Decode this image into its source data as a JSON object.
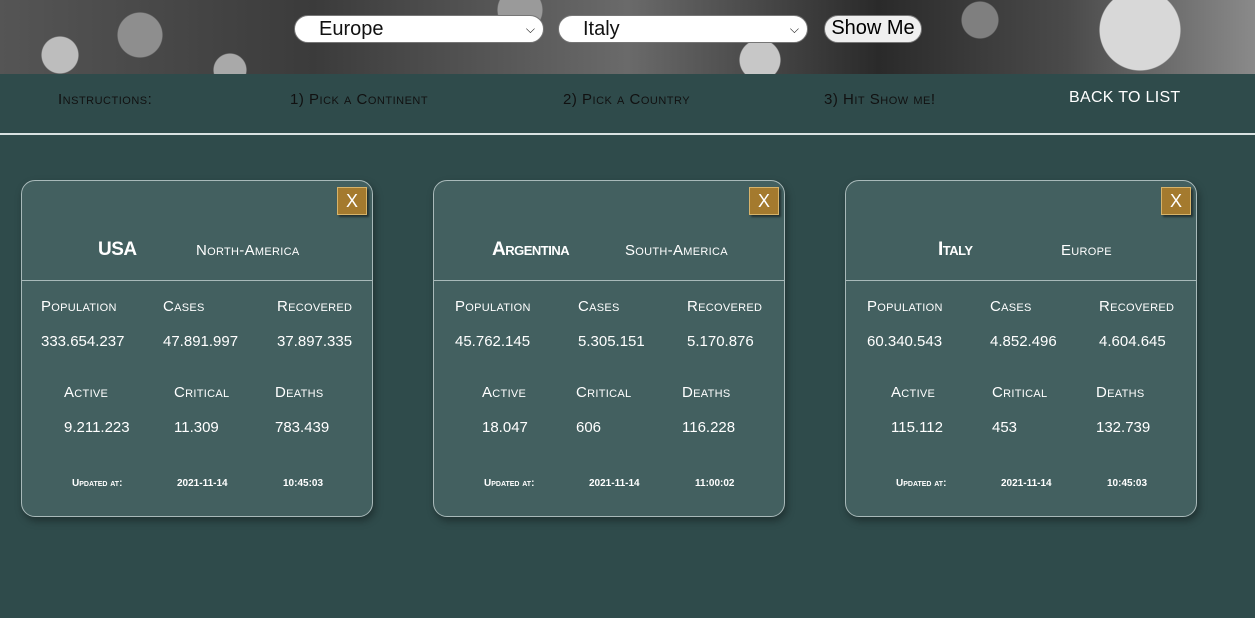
{
  "header": {
    "continent_select": "Europe",
    "country_select": "Italy",
    "show_button": "Show Me"
  },
  "nav": {
    "instructions": "Instructions:",
    "step1": "1) Pick a Continent",
    "step2": "2) Pick a Country",
    "step3": "3) Hit Show me!",
    "back": "BACK TO LIST"
  },
  "labels": {
    "population": "Population",
    "cases": "Cases",
    "recovered": "Recovered",
    "active": "Active",
    "critical": "Critical",
    "deaths": "Deaths",
    "updated": "Updated at:",
    "close": "X"
  },
  "cards": [
    {
      "country": "USA",
      "continent": "North-America",
      "population": "333.654.237",
      "cases": "47.891.997",
      "recovered": "37.897.335",
      "active": "9.211.223",
      "critical": "11.309",
      "deaths": "783.439",
      "date": "2021-11-14",
      "time": "10:45:03"
    },
    {
      "country": "Argentina",
      "continent": "South-America",
      "population": "45.762.145",
      "cases": "5.305.151",
      "recovered": "5.170.876",
      "active": "18.047",
      "critical": "606",
      "deaths": "116.228",
      "date": "2021-11-14",
      "time": "11:00:02"
    },
    {
      "country": "Italy",
      "continent": "Europe",
      "population": "60.340.543",
      "cases": "4.852.496",
      "recovered": "4.604.645",
      "active": "115.112",
      "critical": "453",
      "deaths": "132.739",
      "date": "2021-11-14",
      "time": "10:45:03"
    }
  ]
}
